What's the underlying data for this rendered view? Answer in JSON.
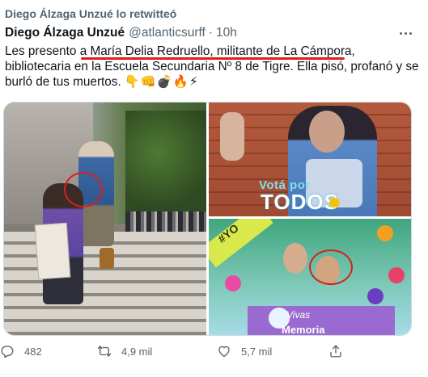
{
  "retweet": {
    "text": "Diego Álzaga Unzué lo retwitteó",
    "icon": "retweet-icon"
  },
  "tweet": {
    "author_name": "Diego Álzaga Unzué",
    "handle": "@atlanticsurff",
    "separator": "·",
    "time": "10h",
    "text_before": "Les presento a ",
    "text_highlight": "María Delia Redruello, militante de La Cámpora,",
    "text_after": " bibliotecaria en la Escuela Secundaria Nº 8 de Tigre. Ella pisó, profanó y se burló de tus muertos.",
    "emoji": "👇👊💣🔥⚡",
    "highlight_color": "#e01e1e"
  },
  "media": {
    "images": [
      {
        "description_icon": "photo-icon"
      },
      {
        "overlay_small": "Votá por",
        "overlay_big": "TODOS"
      },
      {
        "banner": "#YO",
        "line1": "Vivas",
        "line2": "Memoria"
      }
    ],
    "annotation_color": "#d8201c"
  },
  "actions": {
    "reply": {
      "icon": "reply-icon",
      "count": "482"
    },
    "retweet": {
      "icon": "retweet-icon",
      "count": "4,9 mil"
    },
    "like": {
      "icon": "heart-icon",
      "count": "5,7 mil"
    },
    "share": {
      "icon": "share-icon"
    }
  },
  "colors": {
    "muted": "#536471",
    "text": "#0f1419",
    "border": "#cfd9de"
  }
}
